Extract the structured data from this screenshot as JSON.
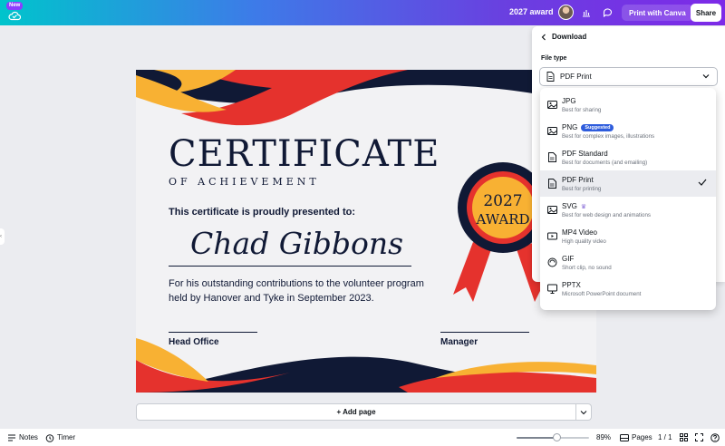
{
  "topbar": {
    "new_badge": "New",
    "doc_title": "2027 award",
    "print_label": "Print with Canva",
    "share_label": "Share",
    "icons": [
      "cloud-check-icon",
      "chart-icon",
      "comment-icon"
    ]
  },
  "certificate": {
    "title": "CERTIFICATE",
    "subtitle": "OF ACHIEVEMENT",
    "presented": "This certificate is proudly presented to:",
    "name": "Chad Gibbons",
    "body": "For his outstanding contributions to the volunteer program held by Hanover and Tyke in September 2023.",
    "medal_line1": "2027",
    "medal_line2": "AWARD",
    "sig_left": "Head Office",
    "sig_right": "Manager",
    "colors": {
      "navy": "#101935",
      "red": "#e5322d",
      "yellow": "#f8b133"
    }
  },
  "canvas": {
    "add_page": "+ Add page"
  },
  "bottombar": {
    "notes": "Notes",
    "timer": "Timer",
    "zoom": "89%",
    "zoom_fraction": 0.55,
    "pages": "Pages",
    "page_count": "1 / 1"
  },
  "download": {
    "header": "Download",
    "file_type_label": "File type",
    "selected": "PDF Print",
    "options": [
      {
        "name": "JPG",
        "desc": "Best for sharing",
        "icon": "image-icon"
      },
      {
        "name": "PNG",
        "badge": "Suggested",
        "desc": "Best for complex images, illustrations",
        "icon": "image-icon"
      },
      {
        "name": "PDF Standard",
        "desc": "Best for documents (and emailing)",
        "icon": "document-icon"
      },
      {
        "name": "PDF Print",
        "desc": "Best for printing",
        "icon": "document-icon",
        "selected": true
      },
      {
        "name": "SVG",
        "desc": "Best for web design and animations",
        "icon": "image-icon",
        "premium": true
      },
      {
        "name": "MP4 Video",
        "desc": "High quality video",
        "icon": "video-icon"
      },
      {
        "name": "GIF",
        "desc": "Short clip, no sound",
        "icon": "gif-icon"
      },
      {
        "name": "PPTX",
        "desc": "Microsoft PowerPoint document",
        "icon": "presentation-icon"
      }
    ],
    "accent": "#2e5cdc"
  }
}
